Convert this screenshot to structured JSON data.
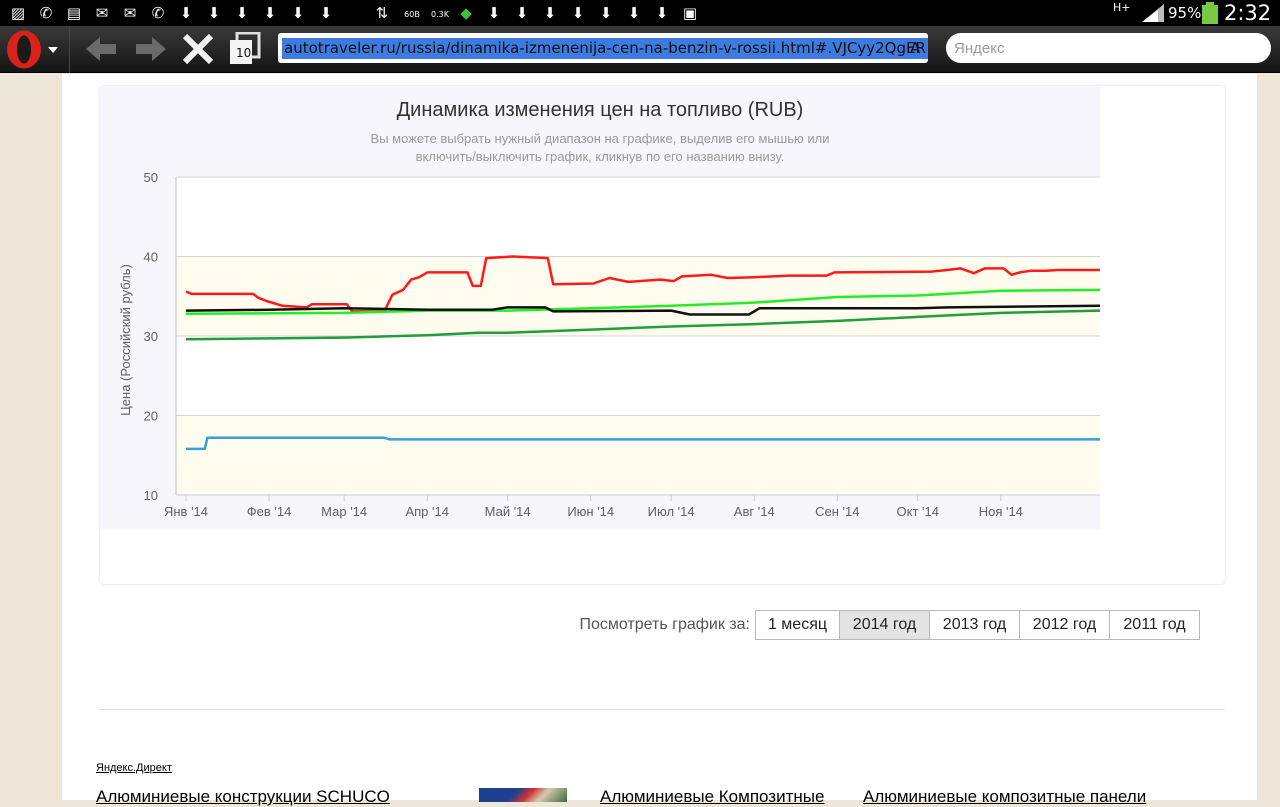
{
  "status_bar": {
    "network": "H+",
    "battery": "95%",
    "time": "2:32",
    "counter_a": "60B",
    "counter_b": "0.3K",
    "notification_icons": [
      "gallery-icon",
      "viber-icon",
      "sim-icon",
      "email-icon",
      "email-icon",
      "phone-icon",
      "download-icon",
      "download-icon",
      "download-icon",
      "download-icon",
      "download-icon",
      "download-icon",
      "sync-icon",
      "data-usage-icon",
      "data-usage-icon",
      "security-icon",
      "download-icon",
      "download-icon",
      "download-icon",
      "download-icon",
      "download-icon",
      "download-icon",
      "download-icon",
      "clipboard-icon"
    ]
  },
  "browser": {
    "tab_count": "10",
    "url": "autotraveler.ru/russia/dinamika-izmenenija-cen-na-benzin-v-rossii.html#.VJCyy2QgER",
    "url_tail": "A",
    "search_placeholder": "Яндекс",
    "colors": {
      "opera_red": "#d8211b",
      "url_selection": "#3d7be0"
    }
  },
  "chart_data": {
    "type": "line",
    "title": "Динамика изменения цен на топливо (RUB)",
    "subtitle_line1": "Вы можете выбрать нужный диапазон на графике, выделив его мышью или",
    "subtitle_line2": "включить/выключить график, кликнув по его названию внизу.",
    "ylabel": "Цена (Российский рубль)",
    "ylim": [
      10,
      50
    ],
    "yticks": [
      "10",
      "20",
      "30",
      "40",
      "50"
    ],
    "x_range": [
      "2014-01-01",
      "2014-12-08"
    ],
    "xticks": [
      "Янв '14",
      "Фев '14",
      "Мар '14",
      "Апр '14",
      "Май '14",
      "Июн '14",
      "Июл '14",
      "Авг '14",
      "Сен '14",
      "Окт '14",
      "Ноя '14"
    ],
    "xtick_dates": [
      "2014-01-01",
      "2014-02-01",
      "2014-03-01",
      "2014-04-01",
      "2014-05-01",
      "2014-06-01",
      "2014-07-01",
      "2014-08-01",
      "2014-09-01",
      "2014-10-01",
      "2014-11-01"
    ],
    "plot_bands": [
      [
        10,
        20
      ],
      [
        30,
        40
      ]
    ],
    "series": [
      {
        "color": "#ff1a1a",
        "points": [
          [
            "2014-01-01",
            35.6
          ],
          [
            "2014-01-03",
            35.3
          ],
          [
            "2014-01-26",
            35.3
          ],
          [
            "2014-01-28",
            34.8
          ],
          [
            "2014-01-31",
            34.4
          ],
          [
            "2014-02-06",
            33.8
          ],
          [
            "2014-02-15",
            33.6
          ],
          [
            "2014-02-17",
            34.0
          ],
          [
            "2014-03-02",
            34.0
          ],
          [
            "2014-03-04",
            33.1
          ],
          [
            "2014-03-16",
            33.1
          ],
          [
            "2014-03-19",
            35.2
          ],
          [
            "2014-03-23",
            35.8
          ],
          [
            "2014-03-26",
            37.1
          ],
          [
            "2014-03-29",
            37.4
          ],
          [
            "2014-04-01",
            38.0
          ],
          [
            "2014-04-16",
            38.0
          ],
          [
            "2014-04-18",
            36.3
          ],
          [
            "2014-04-21",
            36.3
          ],
          [
            "2014-04-23",
            39.8
          ],
          [
            "2014-05-03",
            40.0
          ],
          [
            "2014-05-16",
            39.8
          ],
          [
            "2014-05-18",
            36.5
          ],
          [
            "2014-06-02",
            36.6
          ],
          [
            "2014-06-08",
            37.3
          ],
          [
            "2014-06-15",
            36.8
          ],
          [
            "2014-06-27",
            37.1
          ],
          [
            "2014-07-02",
            36.9
          ],
          [
            "2014-07-05",
            37.5
          ],
          [
            "2014-07-16",
            37.7
          ],
          [
            "2014-07-22",
            37.3
          ],
          [
            "2014-08-01",
            37.4
          ],
          [
            "2014-08-14",
            37.6
          ],
          [
            "2014-08-28",
            37.6
          ],
          [
            "2014-08-31",
            38.0
          ],
          [
            "2014-10-06",
            38.1
          ],
          [
            "2014-10-12",
            38.3
          ],
          [
            "2014-10-17",
            38.5
          ],
          [
            "2014-10-22",
            37.9
          ],
          [
            "2014-10-26",
            38.5
          ],
          [
            "2014-11-02",
            38.5
          ],
          [
            "2014-11-05",
            37.7
          ],
          [
            "2014-11-08",
            38.0
          ],
          [
            "2014-11-12",
            38.2
          ],
          [
            "2014-11-18",
            38.2
          ],
          [
            "2014-11-22",
            38.3
          ],
          [
            "2014-12-08",
            38.3
          ]
        ]
      },
      {
        "color": "#22ee22",
        "points": [
          [
            "2014-01-01",
            32.8
          ],
          [
            "2014-03-01",
            32.9
          ],
          [
            "2014-04-01",
            33.2
          ],
          [
            "2014-05-01",
            33.2
          ],
          [
            "2014-06-01",
            33.5
          ],
          [
            "2014-07-01",
            33.8
          ],
          [
            "2014-08-01",
            34.2
          ],
          [
            "2014-09-01",
            34.9
          ],
          [
            "2014-10-01",
            35.1
          ],
          [
            "2014-11-01",
            35.7
          ],
          [
            "2014-12-08",
            35.8
          ]
        ]
      },
      {
        "color": "#111111",
        "points": [
          [
            "2014-01-01",
            33.2
          ],
          [
            "2014-02-01",
            33.3
          ],
          [
            "2014-03-01",
            33.5
          ],
          [
            "2014-04-01",
            33.3
          ],
          [
            "2014-04-25",
            33.3
          ],
          [
            "2014-05-01",
            33.6
          ],
          [
            "2014-05-15",
            33.6
          ],
          [
            "2014-05-18",
            33.1
          ],
          [
            "2014-07-01",
            33.2
          ],
          [
            "2014-07-08",
            32.7
          ],
          [
            "2014-07-30",
            32.7
          ],
          [
            "2014-08-03",
            33.5
          ],
          [
            "2014-10-01",
            33.5
          ],
          [
            "2014-10-12",
            33.6
          ],
          [
            "2014-12-08",
            33.8
          ]
        ]
      },
      {
        "color": "#1f9e3a",
        "points": [
          [
            "2014-01-01",
            29.6
          ],
          [
            "2014-02-01",
            29.7
          ],
          [
            "2014-03-01",
            29.8
          ],
          [
            "2014-04-01",
            30.1
          ],
          [
            "2014-04-20",
            30.4
          ],
          [
            "2014-05-01",
            30.4
          ],
          [
            "2014-06-01",
            30.8
          ],
          [
            "2014-07-01",
            31.2
          ],
          [
            "2014-08-01",
            31.5
          ],
          [
            "2014-09-01",
            31.9
          ],
          [
            "2014-10-01",
            32.4
          ],
          [
            "2014-11-01",
            32.9
          ],
          [
            "2014-12-08",
            33.2
          ]
        ]
      },
      {
        "color": "#3a9ed8",
        "points": [
          [
            "2014-01-01",
            15.8
          ],
          [
            "2014-01-08",
            15.8
          ],
          [
            "2014-01-09",
            17.2
          ],
          [
            "2014-03-16",
            17.2
          ],
          [
            "2014-03-18",
            17.0
          ],
          [
            "2014-12-08",
            17.0
          ]
        ]
      }
    ]
  },
  "range_selector": {
    "label": "Посмотреть график за:",
    "options": [
      "1 месяц",
      "2014 год",
      "2013 год",
      "2012 год",
      "2011 год"
    ],
    "active": "2014 год"
  },
  "ads": {
    "section_label": "Яндекс.Директ",
    "titles": [
      "Алюминиевые конструкции SCHUCO",
      "Алюминиевые Композитные",
      "Алюминиевые композитные панели"
    ]
  }
}
